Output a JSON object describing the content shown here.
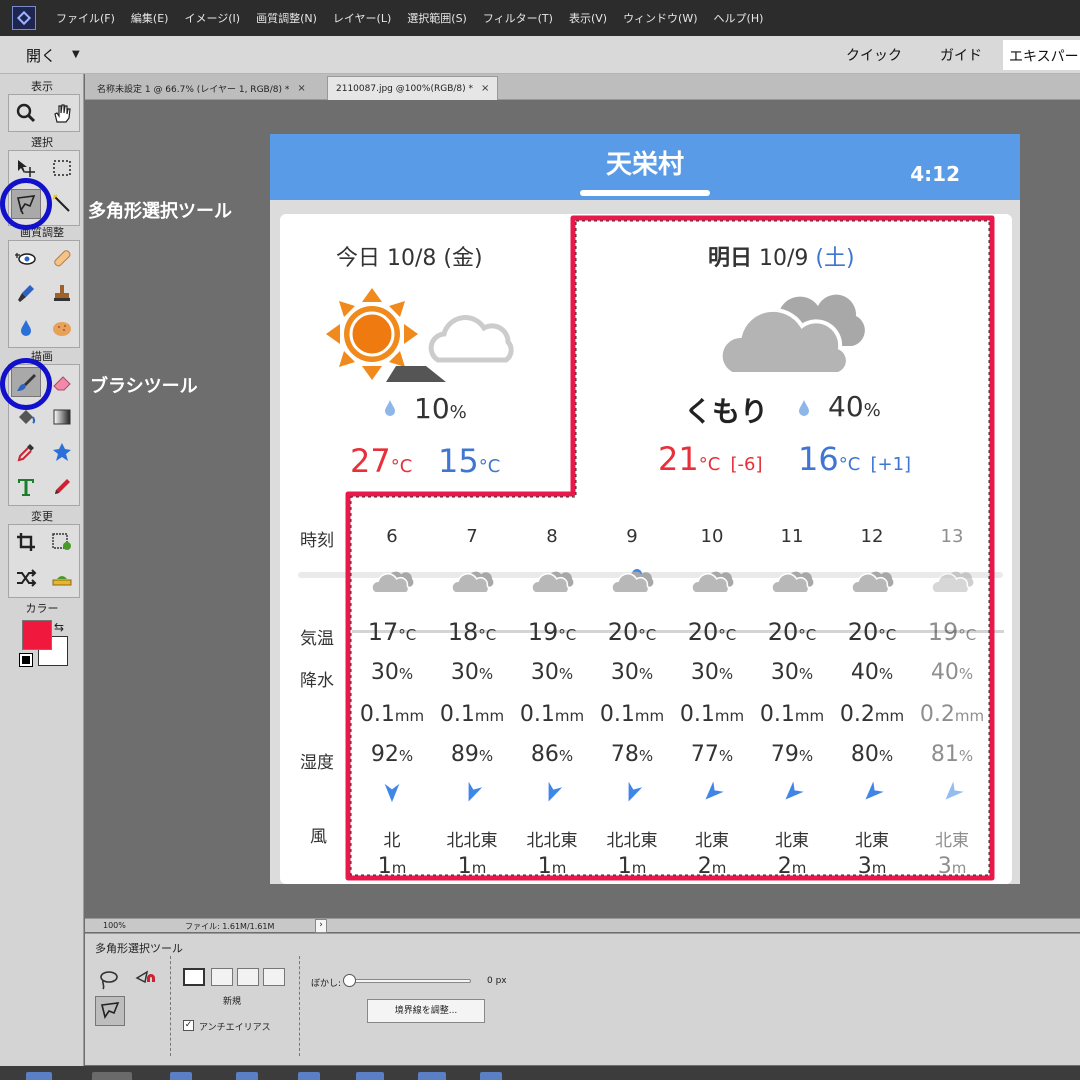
{
  "menu": [
    "ファイル(F)",
    "編集(E)",
    "イメージ(I)",
    "画質調整(N)",
    "レイヤー(L)",
    "選択範囲(S)",
    "フィルター(T)",
    "表示(V)",
    "ウィンドウ(W)",
    "ヘルプ(H)"
  ],
  "modebar": {
    "open_label": "開く",
    "tabs": [
      "クイック",
      "ガイド",
      "エキスパート"
    ]
  },
  "toolbox": {
    "sections": [
      "表示",
      "選択",
      "画質調整",
      "描画",
      "変更",
      "カラー"
    ]
  },
  "doc_tabs": [
    {
      "label": "名称未設定 1 @ 66.7% (レイヤー 1, RGB/8) *",
      "close": "×"
    },
    {
      "label": "2110087.jpg @100%(RGB/8) *",
      "close": "×"
    }
  ],
  "callouts": {
    "polygon_tool": "多角形選択ツール",
    "brush_tool": "ブラシツール"
  },
  "weather": {
    "location": "天栄村",
    "time": "4:12",
    "today": {
      "label": "今日 10/8 (金)",
      "precip": "10",
      "high": "27",
      "low": "15"
    },
    "tomorrow": {
      "label_prefix": "明日",
      "date": "10/9",
      "weekday": "(土)",
      "condition": "くもり",
      "precip": "40",
      "high": "21",
      "high_diff": "[-6]",
      "low": "16",
      "low_diff": "[+1]"
    },
    "units": {
      "pct": "%",
      "deg": "°C",
      "mm": "mm",
      "m": "m"
    },
    "row_labels": {
      "hour": "時刻",
      "temp": "気温",
      "rain": "降水",
      "humidity": "湿度",
      "wind": "風"
    },
    "hours": [
      {
        "hour": "6",
        "temp": "17",
        "rain": "30",
        "mm": "0.1",
        "hum": "92",
        "dir": "北",
        "spd": "1"
      },
      {
        "hour": "7",
        "temp": "18",
        "rain": "30",
        "mm": "0.1",
        "hum": "89",
        "dir": "北北東",
        "spd": "1"
      },
      {
        "hour": "8",
        "temp": "19",
        "rain": "30",
        "mm": "0.1",
        "hum": "86",
        "dir": "北北東",
        "spd": "1"
      },
      {
        "hour": "9",
        "temp": "20",
        "rain": "30",
        "mm": "0.1",
        "hum": "78",
        "dir": "北北東",
        "spd": "1"
      },
      {
        "hour": "10",
        "temp": "20",
        "rain": "30",
        "mm": "0.1",
        "hum": "77",
        "dir": "北東",
        "spd": "2"
      },
      {
        "hour": "11",
        "temp": "20",
        "rain": "30",
        "mm": "0.1",
        "hum": "79",
        "dir": "北東",
        "spd": "2"
      },
      {
        "hour": "12",
        "temp": "20",
        "rain": "40",
        "mm": "0.2",
        "hum": "80",
        "dir": "北東",
        "spd": "3"
      },
      {
        "hour": "13",
        "temp": "19",
        "rain": "40",
        "mm": "0.2",
        "hum": "81",
        "dir": "北東",
        "spd": "3"
      }
    ]
  },
  "statusbar": {
    "zoom": "100%",
    "file": "ファイル: 1.61M/1.61M"
  },
  "options": {
    "title": "多角形選択ツール",
    "mode_label": "新規",
    "antialias_label": "アンチエイリアス",
    "antialias_checked": true,
    "feather_label": "ぼかし:",
    "feather_value": "0 px",
    "refine_button": "境界線を調整..."
  },
  "colors": {
    "foreground": "#f0183c",
    "background": "#ffffff",
    "selection": "#e8184a",
    "callout_ring": "#1111cc",
    "header": "#5a9be8"
  }
}
